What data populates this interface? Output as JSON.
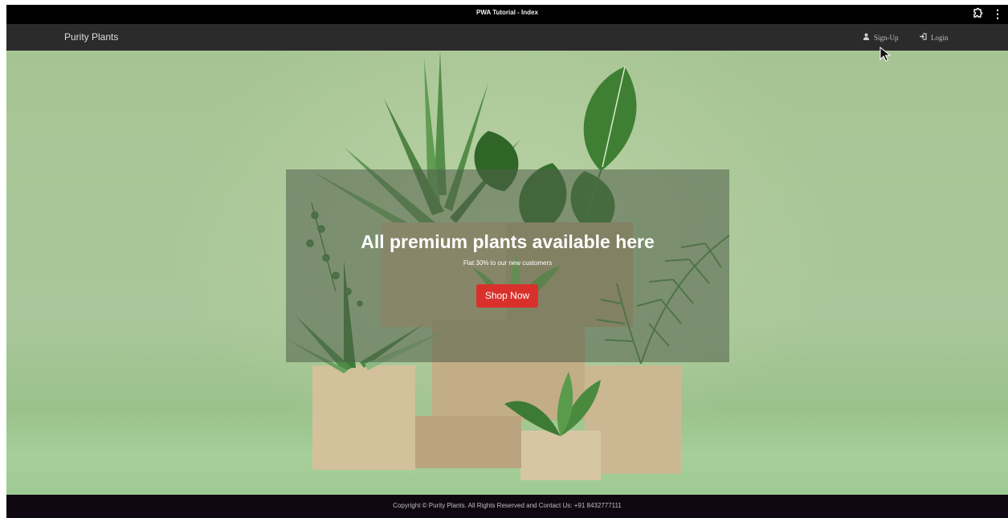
{
  "window": {
    "title": "PWA Tutorial - Index",
    "extensions_icon": "puzzle-icon",
    "menu_icon": "kebab-menu-icon"
  },
  "navbar": {
    "brand": "Purity Plants",
    "links": [
      {
        "label": "Sign-Up",
        "icon": "user-icon"
      },
      {
        "label": "Login",
        "icon": "login-icon"
      }
    ]
  },
  "hero": {
    "heading": "All premium plants available here",
    "subheading": "Flat 30% to our new customers",
    "cta_label": "Shop Now",
    "cta_color": "#d9302c"
  },
  "footer": {
    "text": "Copyright © Purity Plants. All Rights Reserved and Contact Us: +91 8432777111"
  }
}
